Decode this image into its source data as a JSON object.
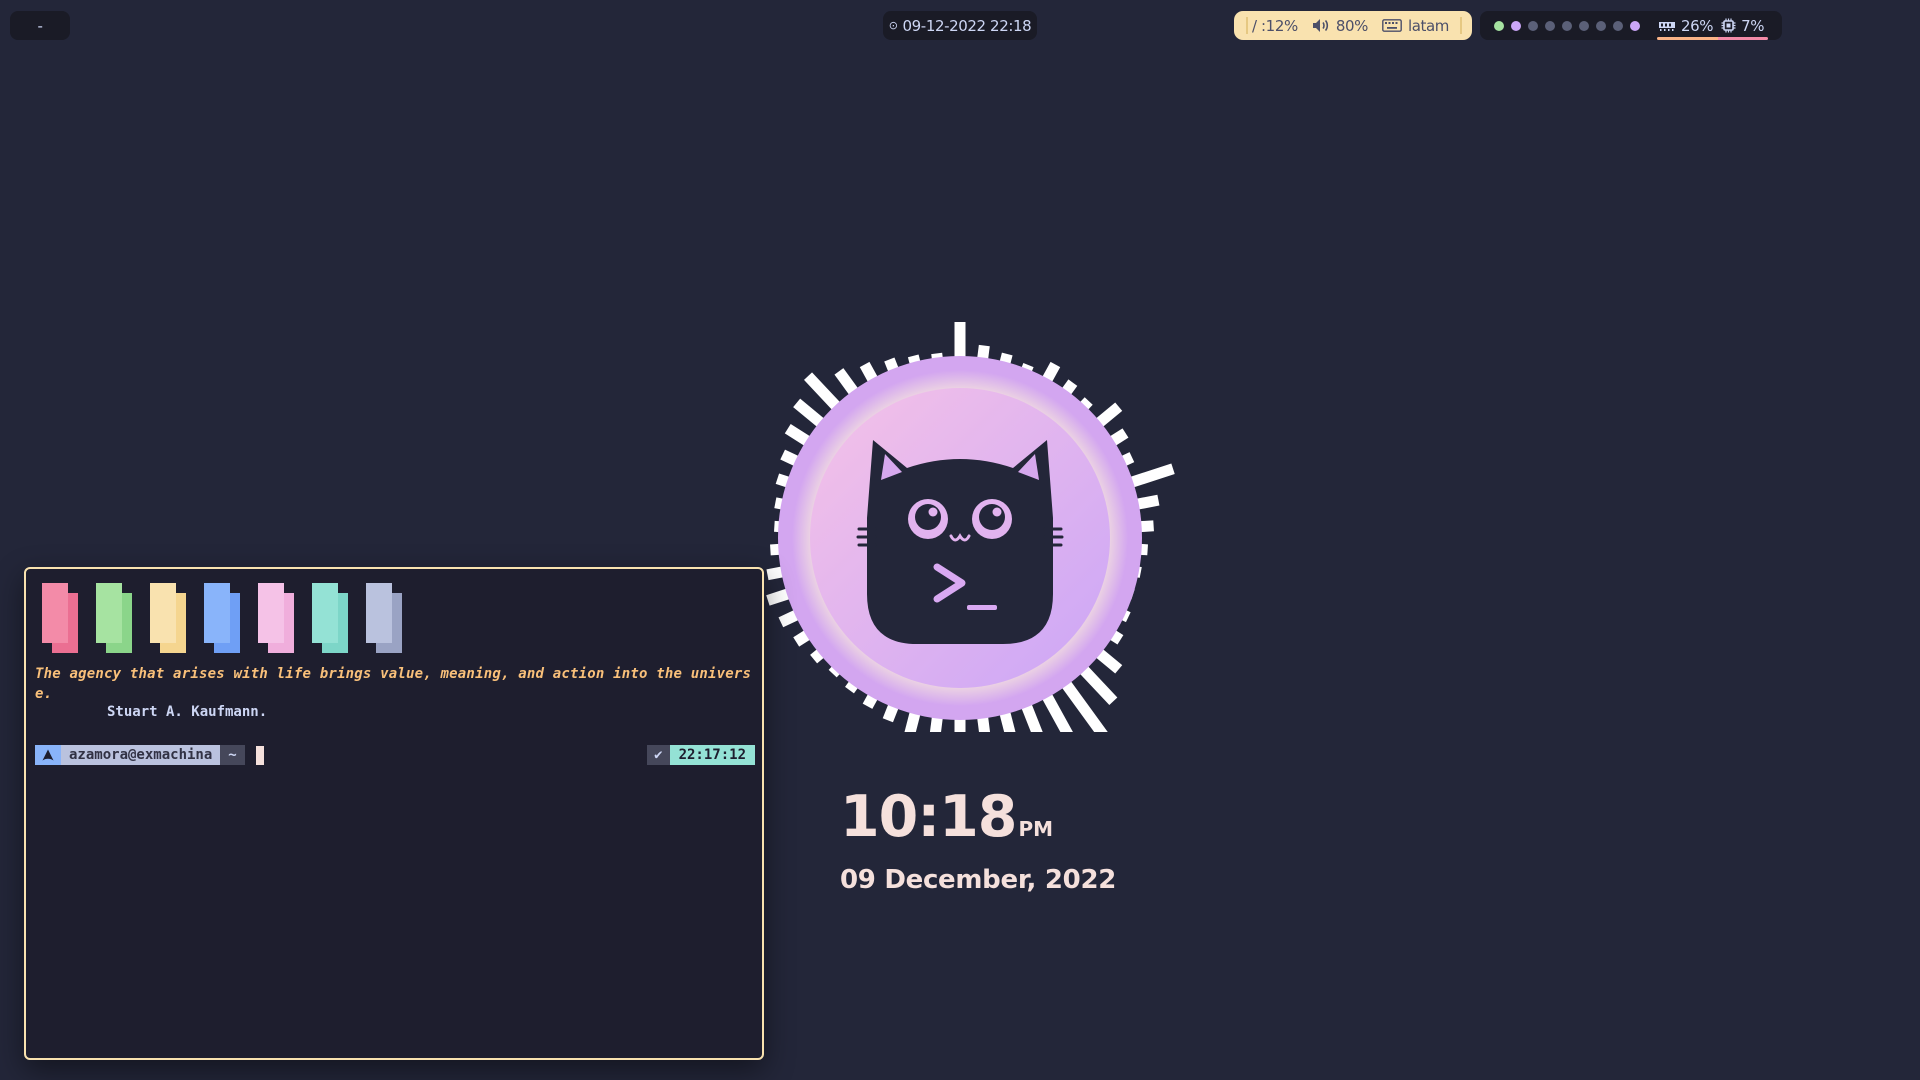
{
  "topbar": {
    "left_label": "-",
    "clock": {
      "icon": "clock-icon",
      "text": "09-12-2022 22:18"
    },
    "system": {
      "disk": "/ :12%",
      "volume_icon": "volume-icon",
      "volume": "80%",
      "keyboard_icon": "keyboard-icon",
      "layout": "latam"
    },
    "workspaces": {
      "dots": [
        "green",
        "purple",
        "gray",
        "gray",
        "gray",
        "gray",
        "gray",
        "gray",
        "purple"
      ],
      "ram_icon": "ram-icon",
      "ram": "26%",
      "cpu_icon": "cpu-icon",
      "cpu": "7%"
    }
  },
  "desktop": {
    "time": "10:18",
    "ampm": "PM",
    "date": "09 December, 2022",
    "emblem_icon": "terminal-cat-icon"
  },
  "terminal": {
    "swatches": [
      {
        "a": "#f38ba8",
        "b": "#eb6f92"
      },
      {
        "a": "#a6e3a1",
        "b": "#8bd58a"
      },
      {
        "a": "#f9e2af",
        "b": "#f5d58f"
      },
      {
        "a": "#89b4fa",
        "b": "#6f9ff5"
      },
      {
        "a": "#f5c2e7",
        "b": "#f0aedc"
      },
      {
        "a": "#94e2d5",
        "b": "#7dd6c8"
      },
      {
        "a": "#bac2de",
        "b": "#9aa3c4"
      }
    ],
    "quote": "The agency that arises with life brings value, meaning, and action into the universe.",
    "author": "Stuart A. Kaufmann.",
    "prompt": {
      "arch_icon": "arch-icon",
      "user": "azamora@exmachina",
      "dir": "~",
      "status": "✔",
      "time": "22:17:12"
    }
  },
  "colors": {
    "background": "#232639",
    "accent_yellow": "#f9e2af",
    "accent_purple": "#cba6f7"
  }
}
